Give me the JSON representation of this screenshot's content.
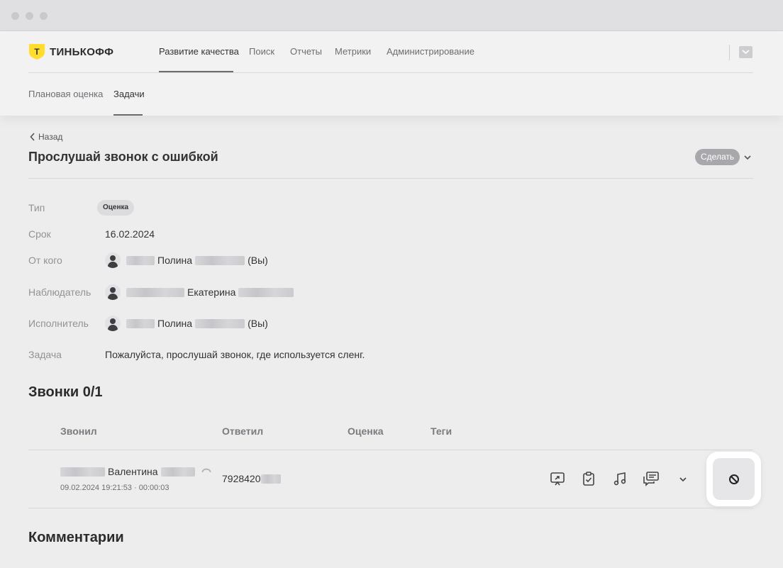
{
  "app": {
    "logo_text": "ТИНЬКОФФ",
    "logo_mark": "Т",
    "colors": {
      "brand_yellow": "#ffdd2d",
      "highlight_bg": "#ffffff"
    }
  },
  "nav": {
    "items": [
      {
        "label": "Развитие качества",
        "active": true
      },
      {
        "label": "Поиск",
        "active": false
      },
      {
        "label": "Отчеты",
        "active": false
      },
      {
        "label": "Метрики",
        "active": false
      },
      {
        "label": "Администрирование",
        "active": false
      }
    ],
    "inbox_icon": "inbox-icon"
  },
  "subnav": {
    "items": [
      {
        "label": "Плановая оценка",
        "active": false
      },
      {
        "label": "Задачи",
        "active": true
      }
    ]
  },
  "task": {
    "back_label": "Назад",
    "title": "Прослушай звонок с ошибкой",
    "do_label": "Сделать",
    "fields": {
      "type_label": "Тип",
      "type_value": "Оценка",
      "due_label": "Срок",
      "due_value": "16.02.2024",
      "from_label": "От кого",
      "from_name": "Полина",
      "from_suffix": "(Вы)",
      "observer_label": "Наблюдатель",
      "observer_name": "Екатерина",
      "assignee_label": "Исполнитель",
      "assignee_name": "Полина",
      "assignee_suffix": "(Вы)",
      "task_label": "Задача",
      "task_value": "Пожалуйста, прослушай звонок, где используется сленг."
    }
  },
  "calls": {
    "title": "Звонки 0/1",
    "columns": [
      "Звонил",
      "Ответил",
      "Оценка",
      "Теги"
    ],
    "rows": [
      {
        "caller_name": "Валентина",
        "meta": "09.02.2024 19:21:53 · 00:00:03",
        "answered": "7928420",
        "actions": [
          "share-icon",
          "clipboard-check-icon",
          "music-note-icon",
          "chat-icon",
          "chevron-down-icon",
          "block-icon"
        ]
      }
    ]
  },
  "comments": {
    "title": "Комментарии"
  }
}
